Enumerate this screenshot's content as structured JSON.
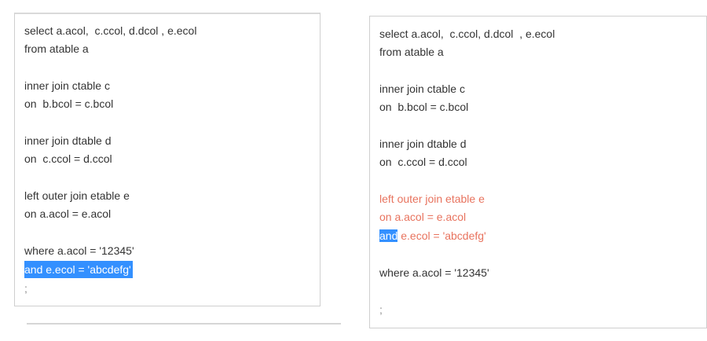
{
  "left_panel": {
    "lines": {
      "select": "select a.acol,  c.ccol, d.dcol , e.ecol",
      "from": "from atable a",
      "join_c": "inner join ctable c",
      "on_c": "on  b.bcol = c.bcol",
      "join_d": "inner join dtable d",
      "on_d": "on  c.ccol = d.ccol",
      "join_e": "left outer join etable e",
      "on_e": "on a.acol = e.acol",
      "where": "where a.acol = '12345'",
      "and": "and e.ecol = 'abcdefg'",
      "semicolon": ";"
    }
  },
  "right_panel": {
    "lines": {
      "select": "select a.acol,  c.ccol, d.dcol  , e.ecol",
      "from": "from atable a",
      "join_c": "inner join ctable c",
      "on_c": "on  b.bcol = c.bcol",
      "join_d": "inner join dtable d",
      "on_d": "on  c.ccol = d.ccol",
      "join_e": "left outer join etable e",
      "on_e": "on a.acol = e.acol",
      "and_keyword": "and",
      "and_rest": " e.ecol = 'abcdefg'",
      "where": "where a.acol = '12345'",
      "semicolon": ";"
    }
  },
  "colors": {
    "text": "#333333",
    "highlight": "#3390ff",
    "moved_text": "#e8735e",
    "border": "#cfcfcf"
  }
}
